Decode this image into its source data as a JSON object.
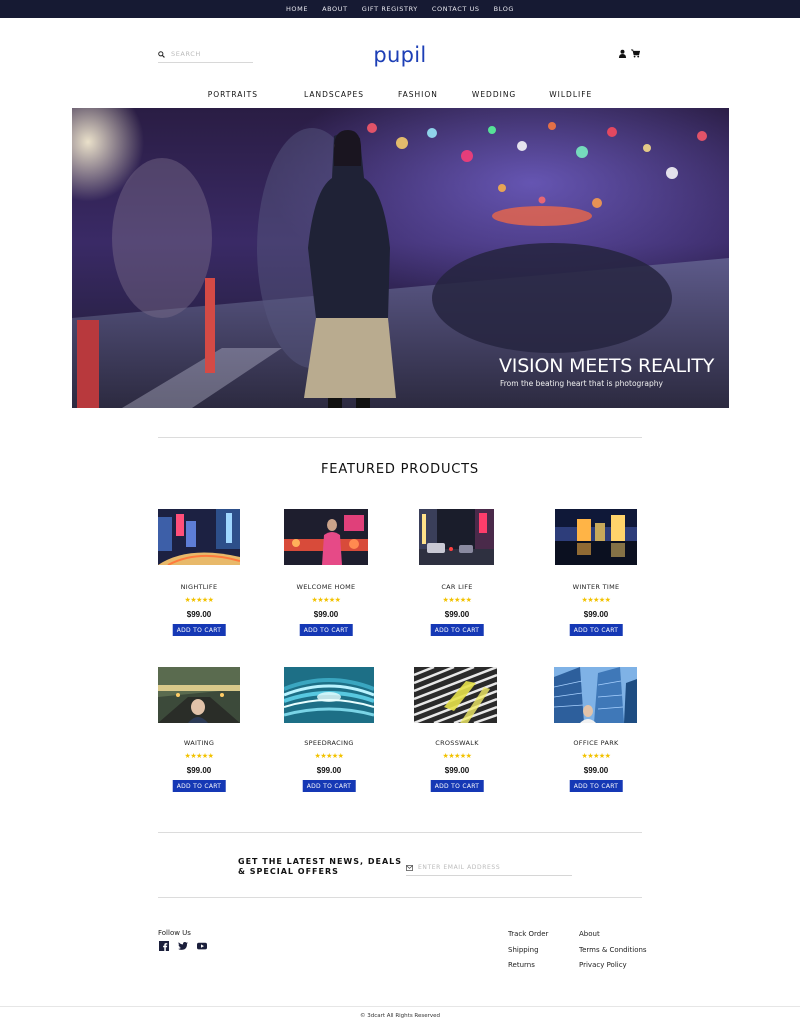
{
  "topnav": {
    "items": [
      "HOME",
      "ABOUT",
      "GIFT REGISTRY",
      "CONTACT US",
      "BLOG"
    ]
  },
  "header": {
    "search_placeholder": "SEARCH",
    "logo": "pupil",
    "icons": [
      "search-icon",
      "user-icon",
      "cart-icon"
    ]
  },
  "catnav": {
    "items": [
      "PORTRAITS",
      "LANDSCAPES",
      "FASHION",
      "WEDDING",
      "WILDLIFE"
    ]
  },
  "hero": {
    "title": "VISION MEETS REALITY",
    "subtitle": "From the beating heart that is photography"
  },
  "featured": {
    "title": "FEATURED PRODUCTS",
    "rating": "★★★★★",
    "products": [
      {
        "name": "NIGHTLIFE",
        "price": "$99.00",
        "button": "ADD TO CART"
      },
      {
        "name": "WELCOME HOME",
        "price": "$99.00",
        "button": "ADD TO CART"
      },
      {
        "name": "CAR LIFE",
        "price": "$99.00",
        "button": "ADD TO CART"
      },
      {
        "name": "WINTER TIME",
        "price": "$99.00",
        "button": "ADD TO CART"
      },
      {
        "name": "WAITING",
        "price": "$99.00",
        "button": "ADD TO CART"
      },
      {
        "name": "SPEEDRACING",
        "price": "$99.00",
        "button": "ADD TO CART"
      },
      {
        "name": "CROSSWALK",
        "price": "$99.00",
        "button": "ADD TO CART"
      },
      {
        "name": "OFFICE PARK",
        "price": "$99.00",
        "button": "ADD TO CART"
      }
    ]
  },
  "newsletter": {
    "heading_line1": "GET THE LATEST NEWS, DEALS",
    "heading_line2": "& SPECIAL OFFERS",
    "email_placeholder": "ENTER EMAIL ADDRESS"
  },
  "footer": {
    "follow_label": "Follow Us",
    "social": [
      "facebook-icon",
      "twitter-icon",
      "youtube-icon"
    ],
    "col1": [
      "Track Order",
      "Shipping",
      "Returns"
    ],
    "col2": [
      "About",
      "Terms & Conditions",
      "Privacy Policy"
    ],
    "copyright": "© 3dcart All Rights Reserved"
  },
  "colors": {
    "topbar": "#161a33",
    "brand": "#1d3fb6",
    "button": "#1538b5",
    "stars": "#f2c200"
  }
}
